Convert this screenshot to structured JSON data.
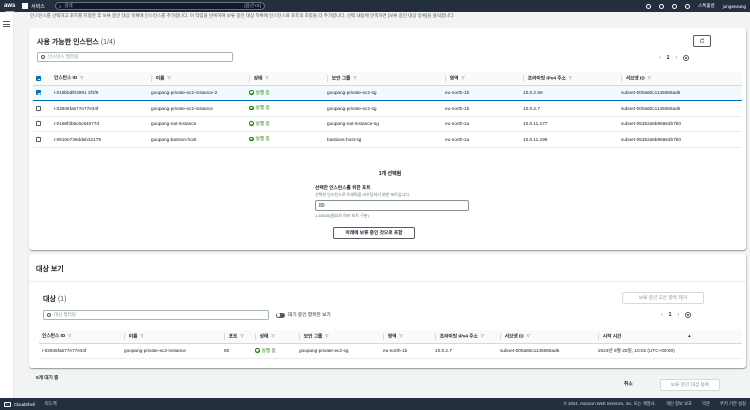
{
  "topnav": {
    "logo": "aws",
    "services": "서비스",
    "search_placeholder": "검색",
    "search_hint": "[옵션+S]",
    "region": "스톡홀름",
    "user": "jongseoung"
  },
  "info_line": "인스턴스를 선택하고 포트를 지정한 후 보류 중인 대상 목록에 인스턴스를 추가합니다. 이 작업을 반복하여 보류 중인 대상 목록에 인스턴스와 포트의 조합을 더 추가합니다. 선택 내용에 만족하면 [보류 중인 대상 등록]을 클릭합니다.",
  "available": {
    "title": "사용 가능한 인스턴스",
    "count": "(1/4)",
    "filter_placeholder": "인스턴스 필터링",
    "page": "1",
    "columns": [
      "인스턴스 ID",
      "이름",
      "상태",
      "보안 그룹",
      "영역",
      "프라이빗 IPv4 주소",
      "서브넷 ID"
    ],
    "rows": [
      {
        "id": "i-015bbdf03991 3f1f9",
        "name": "goopang-private-ec2-instance-2",
        "status": "실행 중",
        "sg": "goopang-private-ec2-sg",
        "zone": "eu-north-1b",
        "ip": "10.0.2.59",
        "subnet": "subnet-000a60c1145065ad6",
        "selected": true
      },
      {
        "id": "i-02945fa677e77e34f",
        "name": "goopang-private-ec2-instance",
        "status": "실행 중",
        "sg": "goopang-private-ec2-sg",
        "zone": "eu-north-1b",
        "ip": "10.0.2.7",
        "subnet": "subnet-000a60c1145065ad6",
        "selected": false
      },
      {
        "id": "i-0168f3b6c6c64077d",
        "name": "goopang-nat-instance",
        "status": "실행 중",
        "sg": "goopang-nat-instance-sg",
        "zone": "eu-north-1a",
        "ip": "10.0.11.177",
        "subnet": "subnet-05352a5b85654b7b0",
        "selected": false
      },
      {
        "id": "i-0910e739ddeb32179",
        "name": "goopang-bastion-host",
        "status": "실행 중",
        "sg": "bastions-host-sg",
        "zone": "eu-north-1a",
        "ip": "10.0.11.198",
        "subnet": "subnet-05352a5b85654b7b0",
        "selected": false
      }
    ]
  },
  "port": {
    "selected_count": "1개 선택됨",
    "label": "선택한 인스턴스를 위한 포트",
    "description": "선택한 인스턴스로 트래픽을 라우팅하기 위한 포트입니다.",
    "value": "80",
    "hint": "1-65535(필요로 여러 포트 구분)",
    "add_button": "아래에 보류 중인 것으로 포함"
  },
  "targets": {
    "section_title": "대상 보기",
    "title": "대상",
    "count": "(1)",
    "remove_all": "보류 중인 모든 항목 제거",
    "filter_placeholder": "대상 필터링",
    "toggle_label": "대기 중인 항목만 보기",
    "page": "1",
    "columns": [
      "인스턴스 ID",
      "이름",
      "포트",
      "상태",
      "보안 그룹",
      "영역",
      "프라이빗 IPv4 주소",
      "서브넷 ID",
      "시작 시간"
    ],
    "rows": [
      {
        "id": "i-02945fa677e77e34f",
        "name": "goopang-private-ec2-instance",
        "port": "80",
        "status": "실행 중",
        "sg": "goopang-private-ec2-sg",
        "zone": "eu-north-1b",
        "ip": "10.0.2.7",
        "subnet": "subnet-000a60c1145065ad6",
        "start": "2024년 9월 25일, 10:02 (UTC+09:00)"
      }
    ]
  },
  "bottom": {
    "pending": "0개 대기 중",
    "cancel": "취소",
    "register": "보류 중인 대상 등록"
  },
  "footer": {
    "cloudshell": "CloudShell",
    "feedback": "피드백",
    "copyright": "© 2024, Amazon Web Services, Inc. 또는 계열사.",
    "privacy": "개인 정보 보호",
    "terms": "약관",
    "cookies": "쿠키 기본 설정"
  }
}
